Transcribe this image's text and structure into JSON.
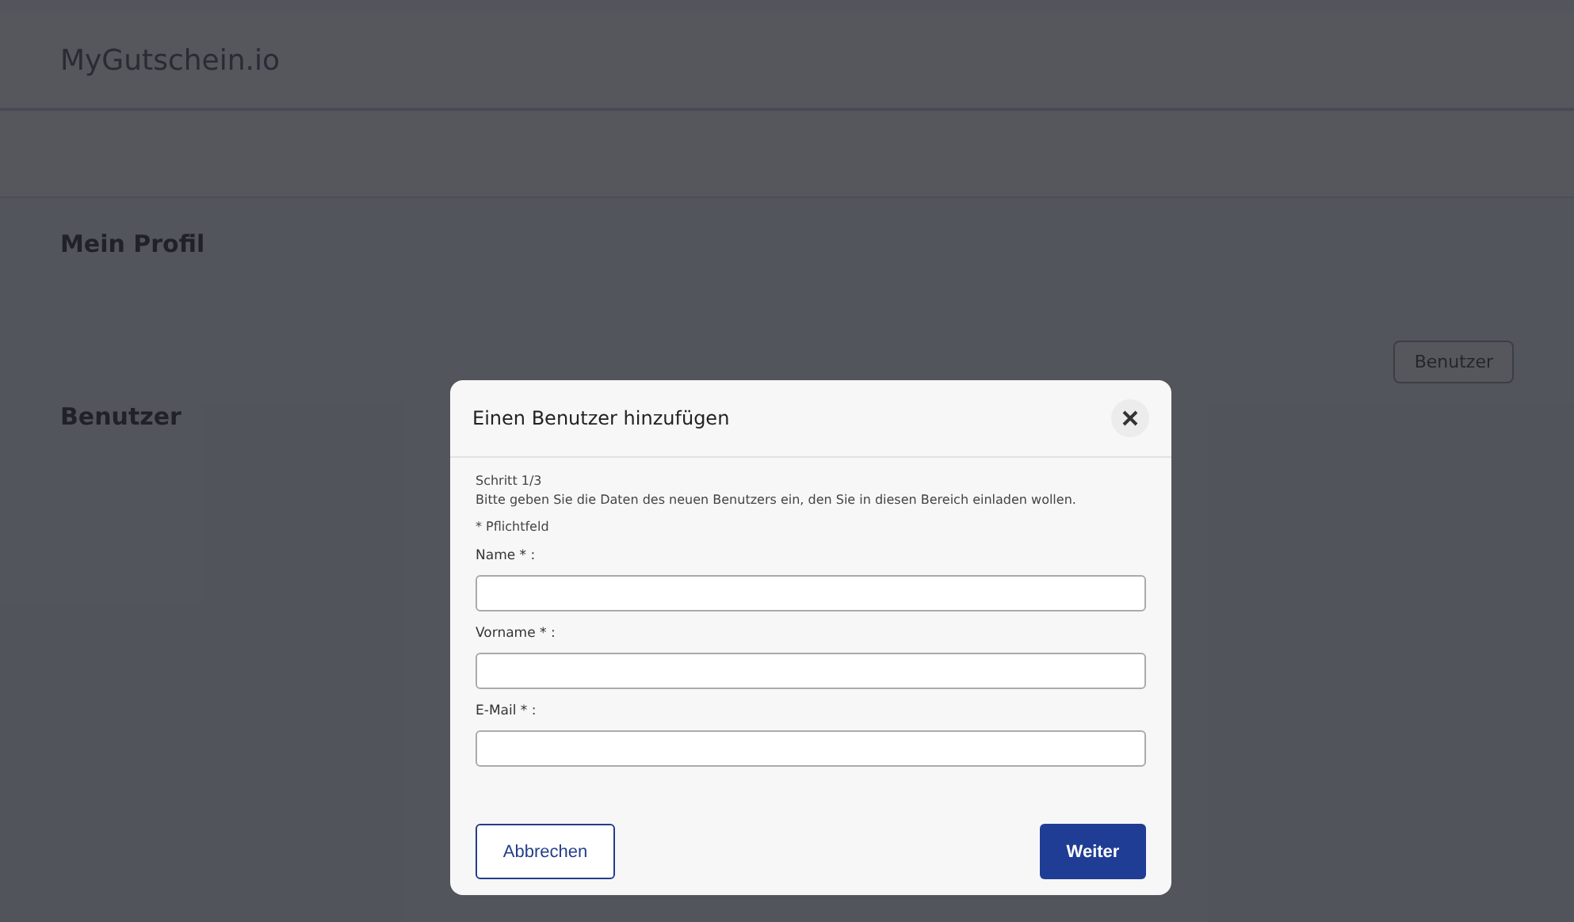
{
  "header": {
    "logo": "MyGutschein.io"
  },
  "page": {
    "title": "Mein Profil",
    "section_title": "Benutzer",
    "tabs": [
      {
        "label": "Benutzer",
        "selected": true
      }
    ]
  },
  "dialog": {
    "title": "Einen Benutzer hinzufügen",
    "step": "Schritt 1/3",
    "intro": "Bitte geben Sie die Daten des neuen Benutzers ein, den Sie in diesen Bereich einladen wollen.",
    "required_note": "* Pflichtfeld",
    "fields": [
      {
        "label": "Name * :"
      },
      {
        "label": "Vorname * :"
      },
      {
        "label": "E-Mail * :"
      }
    ],
    "cancel": "Abbrechen",
    "next": "Weiter"
  }
}
